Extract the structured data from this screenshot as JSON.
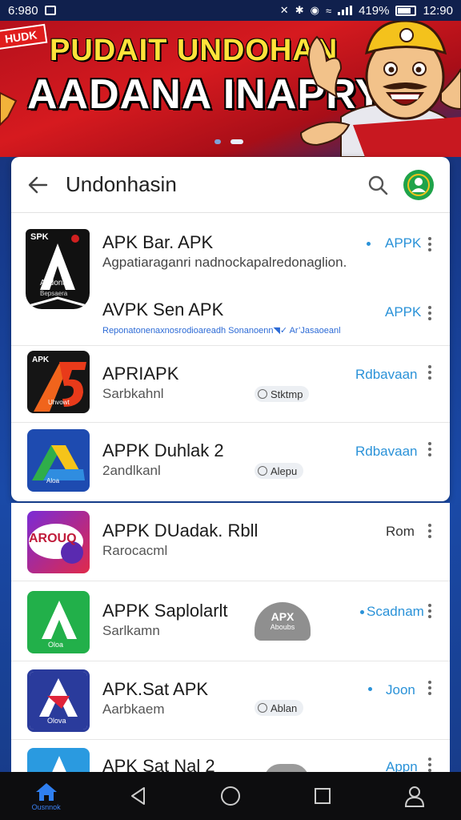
{
  "status_bar": {
    "time_left": "6:980",
    "battery": "419%",
    "clock": "12:90"
  },
  "banner": {
    "tag": "HUDK",
    "headline": "PUDAIT UNDOHAN",
    "subheadline": "AADANA INAPRY"
  },
  "card": {
    "title": "Undonhasin"
  },
  "apps": [
    {
      "name": "APK Bar. APK",
      "description": "Agpatiaraganri nadnockapalredonaglion.",
      "action": "APPK",
      "icon_label_top": "SPK",
      "icon_label_bottom": "Akdonan",
      "icon_label_sub": "Bepsaera"
    },
    {
      "name": "AVPK Sen APK",
      "description": "Reponatonenaxnosrodioareadh Sonanoenn◥✓ Ar’Jasaoeanl",
      "action": "APPK"
    },
    {
      "name": "APRIAPK",
      "sub": "Sarbkahnl",
      "chip": "Stktmp",
      "action": "Rdbavaan",
      "icon_label_top": "APK",
      "icon_label_bottom": "Uhvowt"
    },
    {
      "name": "APPK Duhlak 2",
      "sub": "2andlkanl",
      "chip": "Alepu",
      "action": "Rdbavaan",
      "icon_label_bottom": "Aloa"
    },
    {
      "name": "APPK DUadak. Rbll",
      "sub": "Rarocacml",
      "action": "Rom",
      "icon_label_top": "AROUQ"
    },
    {
      "name": "APPK Saplolarlt",
      "sub": "Sarlkamn",
      "action": "Scadnam",
      "badge_top": "APX",
      "badge_bottom": "Aboubs",
      "icon_label_bottom": "Oloa"
    },
    {
      "name": "APK.Sat APK",
      "sub": "Aarbkaem",
      "chip": "Ablan",
      "action": "Joon",
      "icon_label_bottom": "Olova"
    },
    {
      "name": "APK Sat Nal 2",
      "action": "Appn"
    }
  ],
  "nav": {
    "home_label": "Ousnnok"
  },
  "colors": {
    "accent": "#2a92d8",
    "banner_red": "#d61a1f",
    "banner_yellow": "#ffe23a",
    "profile_green": "#1fa34a"
  }
}
